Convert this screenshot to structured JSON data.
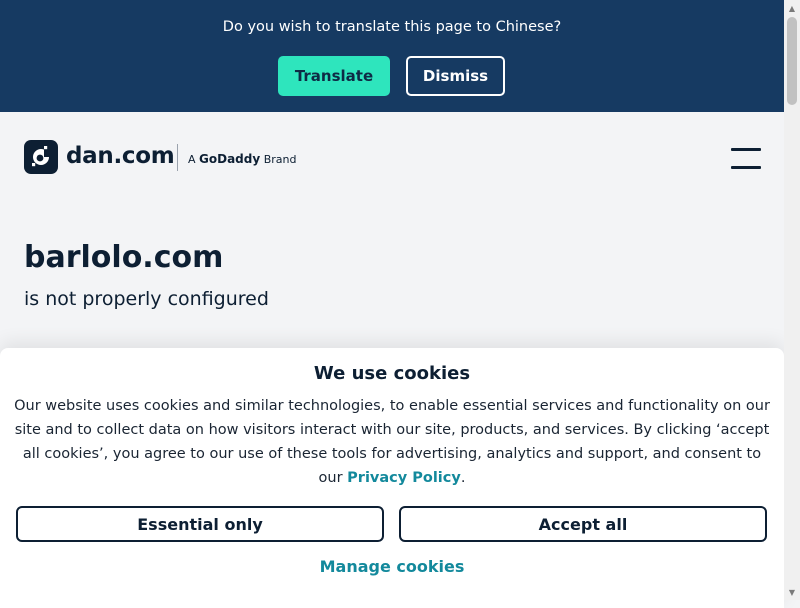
{
  "translate_bar": {
    "question": "Do you wish to translate this page to Chinese?",
    "translate_label": "Translate",
    "dismiss_label": "Dismiss"
  },
  "header": {
    "logo_text": "dan.com",
    "brand_prefix": "A",
    "brand_name": "GoDaddy",
    "brand_suffix": "Brand",
    "menu_icon": "hamburger-icon",
    "logo_icon": "dan-logo-icon"
  },
  "main": {
    "domain": "barlolo.com",
    "status": "is not properly configured"
  },
  "cookie_banner": {
    "title": "We use cookies",
    "body": "Our website uses cookies and similar technologies, to enable essential services and functionality on our site and to collect data on how visitors interact with our site, products, and services. By clicking ‘accept all cookies’, you agree to our use of these tools for advertising, analytics and support, and consent to our",
    "privacy_link": "Privacy Policy",
    "period": ".",
    "essential_label": "Essential only",
    "accept_label": "Accept all",
    "manage_label": "Manage cookies"
  },
  "colors": {
    "translate_bar_bg": "#163a62",
    "translate_button_bg": "#2ee5bd",
    "brand_dark": "#0d1f33",
    "link_teal": "#13899c",
    "page_bg": "#f3f4f6"
  }
}
